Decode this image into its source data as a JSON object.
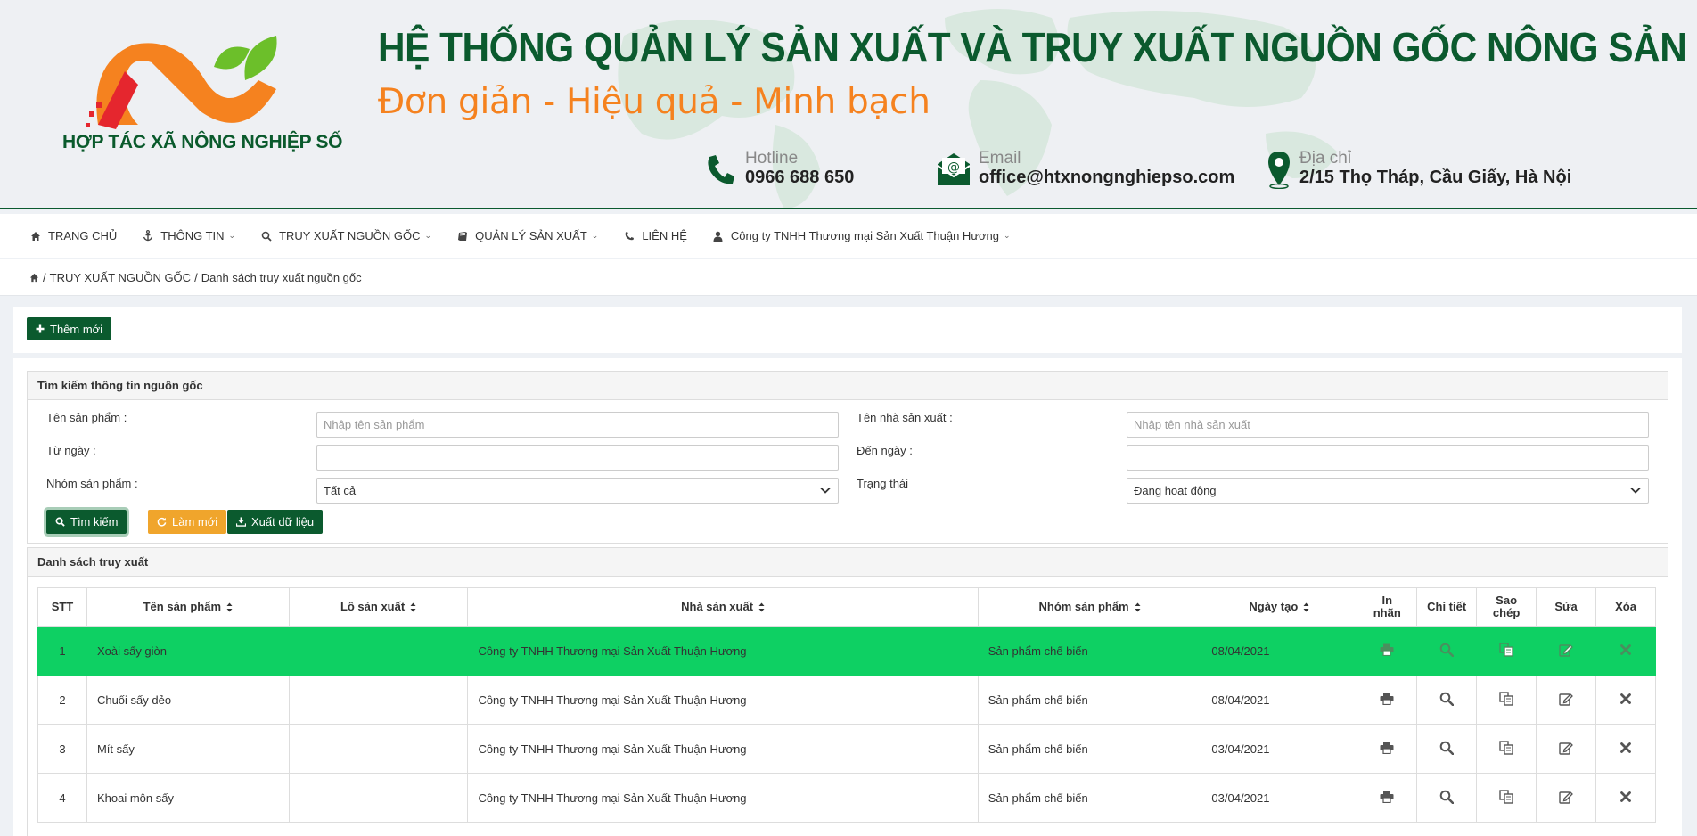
{
  "header": {
    "logo_text": "HỢP TÁC XÃ NÔNG NGHIỆP SỐ",
    "title": "HỆ THỐNG QUẢN LÝ SẢN XUẤT VÀ TRUY XUẤT NGUỒN GỐC NÔNG SẢN",
    "slogan": "Đơn giản -  Hiệu quả - Minh bạch",
    "hotline_label": "Hotline",
    "hotline_value": "0966 688 650",
    "email_label": "Email",
    "email_value": "office@htxnongnghiepso.com",
    "address_label": "Địa chỉ",
    "address_value": "2/15 Thọ Tháp, Cầu Giấy, Hà Nội",
    "colors": {
      "brand_green": "#0b5a2e",
      "accent_orange": "#f5821f"
    }
  },
  "nav": {
    "items": [
      {
        "label": "TRANG CHỦ",
        "icon": "home-icon"
      },
      {
        "label": "THÔNG TIN",
        "icon": "anchor-icon"
      },
      {
        "label": "TRUY XUẤT NGUỒN GỐC",
        "icon": "search-icon"
      },
      {
        "label": "QUẢN LÝ SẢN XUẤT",
        "icon": "book-icon"
      },
      {
        "label": "LIÊN HỆ",
        "icon": "phone-icon"
      },
      {
        "label": "Công ty TNHH Thương mại Sản Xuất Thuận Hương",
        "icon": "user-icon"
      }
    ]
  },
  "breadcrumb": {
    "section": "TRUY XUẤT NGUỒN GỐC",
    "page": "Danh sách truy xuất nguồn gốc"
  },
  "toolbar": {
    "add_label": "Thêm mới"
  },
  "search": {
    "title": "Tìm kiếm thông tin nguồn gốc",
    "product_name_label": "Tên sản phẩm :",
    "product_name_placeholder": "Nhập tên sản phẩm",
    "producer_label": "Tên nhà sản xuất :",
    "producer_placeholder": "Nhập tên nhà sản xuất",
    "from_date_label": "Từ ngày :",
    "to_date_label": "Đến ngày :",
    "group_label": "Nhóm sản phẩm :",
    "group_value": "Tất cả",
    "status_label": "Trạng thái",
    "status_value": "Đang hoạt động",
    "search_button": "Tìm kiếm",
    "reset_button": "Làm mới",
    "export_button": "Xuất dữ liệu"
  },
  "list": {
    "title": "Danh sách truy xuất",
    "columns": {
      "stt": "STT",
      "product": "Tên sản phẩm",
      "batch": "Lô sản xuất",
      "producer": "Nhà sản xuất",
      "group": "Nhóm sản phẩm",
      "created": "Ngày tạo",
      "print_1": "In",
      "print_2": "nhãn",
      "detail": "Chi tiết",
      "copy_1": "Sao",
      "copy_2": "chép",
      "edit": "Sửa",
      "delete": "Xóa"
    },
    "rows": [
      {
        "stt": "1",
        "product": "Xoài sấy giòn",
        "batch": "",
        "producer": "Công ty TNHH Thương mại Sản Xuất Thuận Hương",
        "group": "Sản phẩm chế biến",
        "created": "08/04/2021",
        "active": true
      },
      {
        "stt": "2",
        "product": "Chuối sấy dẻo",
        "batch": "",
        "producer": "Công ty TNHH Thương mại Sản Xuất Thuận Hương",
        "group": "Sản phẩm chế biến",
        "created": "08/04/2021",
        "active": false
      },
      {
        "stt": "3",
        "product": "Mít sấy",
        "batch": "",
        "producer": "Công ty TNHH Thương mại Sản Xuất Thuận Hương",
        "group": "Sản phẩm chế biến",
        "created": "03/04/2021",
        "active": false
      },
      {
        "stt": "4",
        "product": "Khoai môn sấy",
        "batch": "",
        "producer": "Công ty TNHH Thương mại Sản Xuất Thuận Hương",
        "group": "Sản phẩm chế biến",
        "created": "03/04/2021",
        "active": false
      }
    ]
  }
}
